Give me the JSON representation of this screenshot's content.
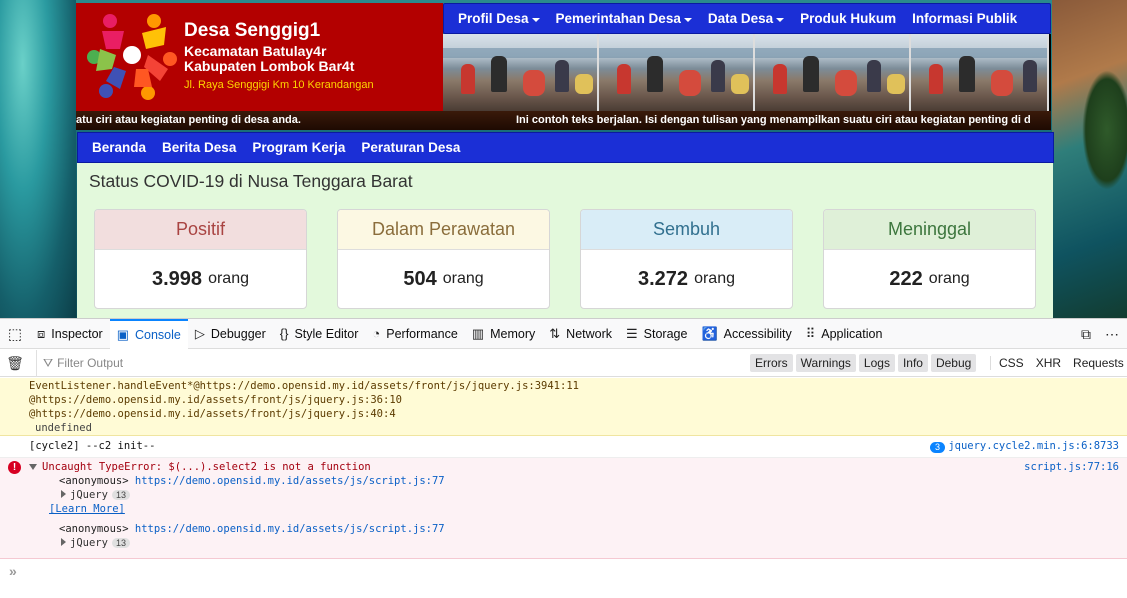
{
  "site": {
    "name": "Desa Senggig1",
    "sub1": "Kecamatan Batulay4r",
    "sub2": "Kabupaten Lombok Bar4t",
    "address": "Jl. Raya Senggigi Km 10 Kerandangan"
  },
  "top_nav": [
    {
      "label": "Profil Desa",
      "dropdown": true
    },
    {
      "label": "Pemerintahan Desa",
      "dropdown": true
    },
    {
      "label": "Data Desa",
      "dropdown": true
    },
    {
      "label": "Produk Hukum",
      "dropdown": false
    },
    {
      "label": "Informasi Publik",
      "dropdown": false
    }
  ],
  "ticker": {
    "part1": "atu ciri atau kegiatan penting di desa anda.",
    "part2": "Ini contoh teks berjalan. Isi dengan tulisan yang menampilkan suatu ciri atau kegiatan penting di d"
  },
  "main_nav": [
    "Beranda",
    "Berita Desa",
    "Program Kerja",
    "Peraturan Desa"
  ],
  "covid": {
    "title": "Status COVID-19 di Nusa Tenggara Barat",
    "unit": "orang",
    "cards": [
      {
        "label": "Positif",
        "value": "3.998",
        "color": "#a94442",
        "bg": "#f2dede"
      },
      {
        "label": "Dalam Perawatan",
        "value": "504",
        "color": "#8a6d3b",
        "bg": "#fcf8e3"
      },
      {
        "label": "Sembuh",
        "value": "3.272",
        "color": "#31708f",
        "bg": "#d9edf7"
      },
      {
        "label": "Meninggal",
        "value": "222",
        "color": "#3c763d",
        "bg": "#dff0d8"
      }
    ]
  },
  "devtools": {
    "tabs": [
      {
        "label": "Inspector",
        "icon": "inspector-icon",
        "glyph": "⧈"
      },
      {
        "label": "Console",
        "icon": "console-icon",
        "glyph": "▣",
        "active": true
      },
      {
        "label": "Debugger",
        "icon": "debugger-icon",
        "glyph": "▷"
      },
      {
        "label": "Style Editor",
        "icon": "style-editor-icon",
        "glyph": "{}"
      },
      {
        "label": "Performance",
        "icon": "performance-icon",
        "glyph": "◔"
      },
      {
        "label": "Memory",
        "icon": "memory-icon",
        "glyph": "▥"
      },
      {
        "label": "Network",
        "icon": "network-icon",
        "glyph": "⇅"
      },
      {
        "label": "Storage",
        "icon": "storage-icon",
        "glyph": "☰"
      },
      {
        "label": "Accessibility",
        "icon": "accessibility-icon",
        "glyph": "♿"
      },
      {
        "label": "Application",
        "icon": "application-icon",
        "glyph": "⠿"
      }
    ],
    "filter_placeholder": "Filter Output",
    "levels": [
      "Errors",
      "Warnings",
      "Logs",
      "Info",
      "Debug"
    ],
    "net_filters": [
      "CSS",
      "XHR",
      "Requests"
    ],
    "warn_lines": [
      "EventListener.handleEvent*@https://demo.opensid.my.id/assets/front/js/jquery.js:3941:11",
      "@https://demo.opensid.my.id/assets/front/js/jquery.js:36:10",
      "@https://demo.opensid.my.id/assets/front/js/jquery.js:40:4"
    ],
    "warn_undefined": "undefined",
    "log": {
      "text": "[cycle2] --c2 init--",
      "count": "3",
      "source": "jquery.cycle2.min.js:6:8733"
    },
    "error": {
      "message": "Uncaught TypeError: $(...).select2 is not a function",
      "source": "script.js:77:16",
      "frame_name": "<anonymous>",
      "frame_url": "https://demo.opensid.my.id/assets/js/script.js:77",
      "jq_label": "jQuery",
      "jq_count": "13",
      "learn_more": "[Learn More]"
    }
  }
}
